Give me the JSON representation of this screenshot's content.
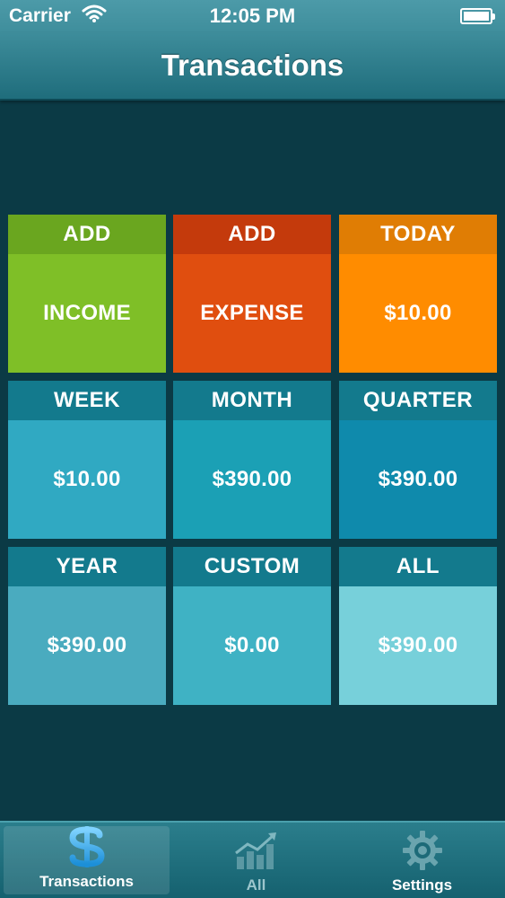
{
  "status_bar": {
    "carrier": "Carrier",
    "time": "12:05 PM"
  },
  "nav": {
    "title": "Transactions"
  },
  "tiles": [
    {
      "head": "ADD",
      "body": "INCOME",
      "head_color": "#6aa61f",
      "body_color": "#7fbf27"
    },
    {
      "head": "ADD",
      "body": "EXPENSE",
      "head_color": "#c43a0c",
      "body_color": "#e04e0f"
    },
    {
      "head": "TODAY",
      "body": "$10.00",
      "head_color": "#e07d04",
      "body_color": "#ff8c00"
    },
    {
      "head": "WEEK",
      "body": "$10.00",
      "head_color": "#137a8d",
      "body_color": "#30a9c2"
    },
    {
      "head": "MONTH",
      "body": "$390.00",
      "head_color": "#137a8d",
      "body_color": "#1ba0b5"
    },
    {
      "head": "QUARTER",
      "body": "$390.00",
      "head_color": "#137a8d",
      "body_color": "#0f8aac"
    },
    {
      "head": "YEAR",
      "body": "$390.00",
      "head_color": "#137a8d",
      "body_color": "#4aabbf"
    },
    {
      "head": "CUSTOM",
      "body": "$0.00",
      "head_color": "#137a8d",
      "body_color": "#3fb2c4"
    },
    {
      "head": "ALL",
      "body": "$390.00",
      "head_color": "#137a8d",
      "body_color": "#77d0da"
    }
  ],
  "tab_bar": {
    "tabs": [
      {
        "label": "Transactions",
        "icon": "dollar-icon",
        "active": true
      },
      {
        "label": "All",
        "icon": "chart-icon",
        "active": false
      },
      {
        "label": "Settings",
        "icon": "gear-icon",
        "active": false
      }
    ]
  }
}
